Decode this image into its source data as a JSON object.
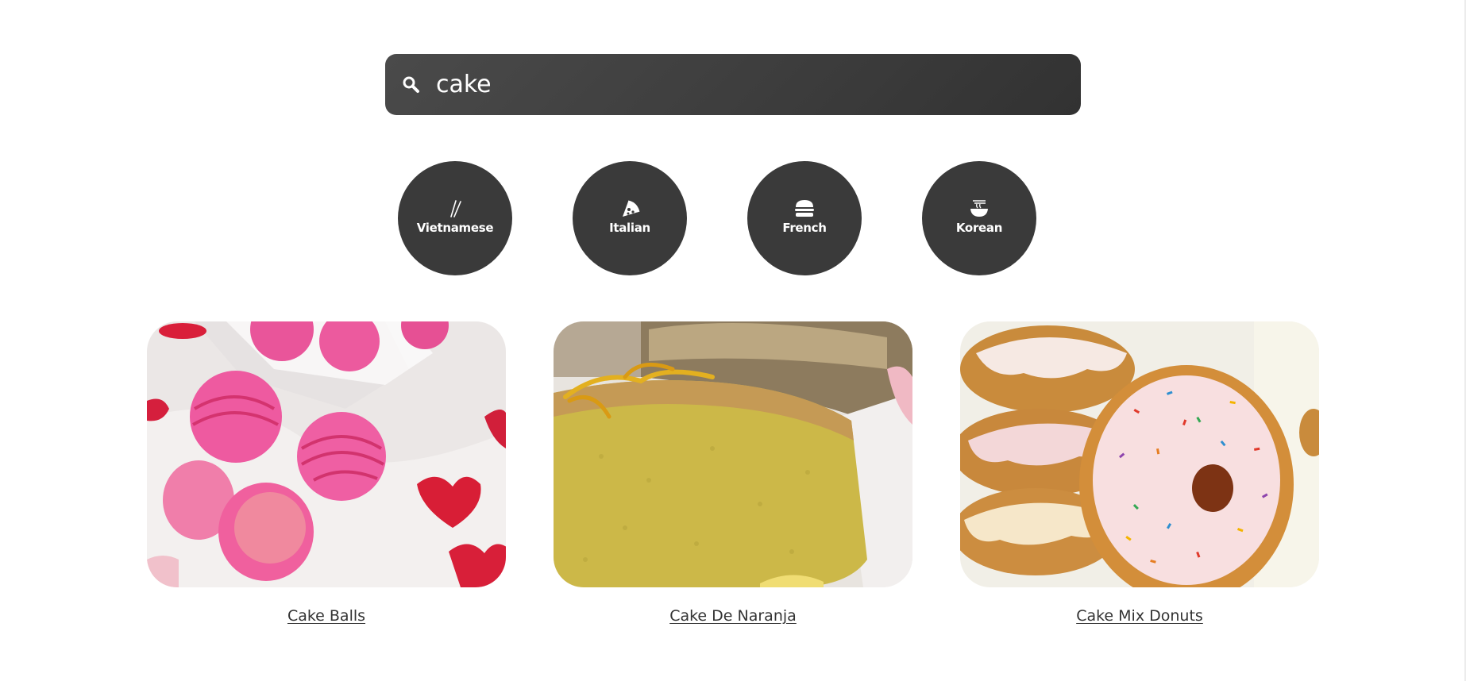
{
  "search": {
    "value": "cake",
    "icon": "search-icon"
  },
  "cuisines": [
    {
      "label": "Vietnamese",
      "icon": "chopsticks-icon"
    },
    {
      "label": "Italian",
      "icon": "pizza-icon"
    },
    {
      "label": "French",
      "icon": "burger-icon"
    },
    {
      "label": "Korean",
      "icon": "noodle-bowl-icon"
    }
  ],
  "recipes": [
    {
      "title": "Cake Balls",
      "image": "pink cake balls photo"
    },
    {
      "title": "Cake De Naranja",
      "image": "orange sponge cake slice photo"
    },
    {
      "title": "Cake Mix Donuts",
      "image": "sprinkled donuts photo"
    }
  ],
  "colors": {
    "search_bg": "#3d3d3d",
    "button_bg": "#3a3a3a",
    "title_text": "#333333"
  }
}
